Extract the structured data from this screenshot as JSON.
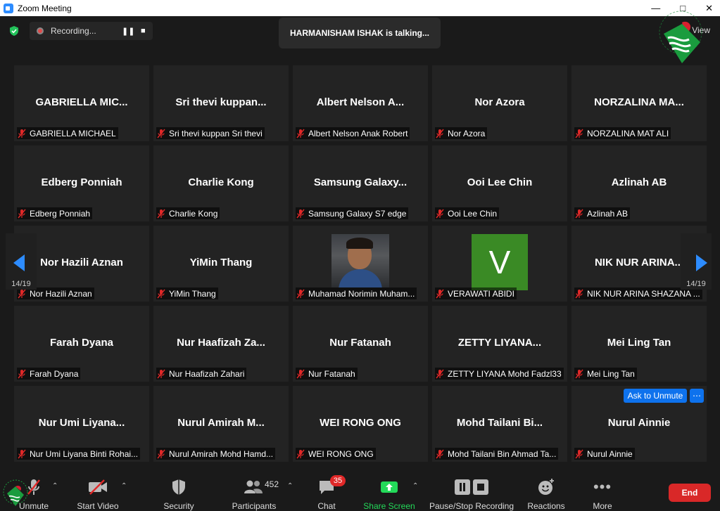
{
  "window": {
    "title": "Zoom Meeting"
  },
  "recording": {
    "label": "Recording..."
  },
  "talking": "HARMANISHAM ISHAK is talking...",
  "view_label": "View",
  "colors": {
    "end": "#d92828",
    "accent": "#0e72ed",
    "share": "#23d959",
    "mic_off": "#e02828"
  },
  "tiles": [
    {
      "name": "GABRIELLA MIC...",
      "label": "GABRIELLA MICHAEL"
    },
    {
      "name": "Sri  thevi  kuppan...",
      "label": "Sri thevi kuppan Sri thevi"
    },
    {
      "name": "Albert  Nelson  A...",
      "label": "Albert Nelson Anak Robert"
    },
    {
      "name": "Nor Azora",
      "label": "Nor Azora"
    },
    {
      "name": "NORZALINA MA...",
      "label": "NORZALINA MAT ALI"
    },
    {
      "name": "Edberg Ponniah",
      "label": "Edberg Ponniah"
    },
    {
      "name": "Charlie Kong",
      "label": "Charlie Kong"
    },
    {
      "name": "Samsung  Galaxy...",
      "label": "Samsung Galaxy S7 edge"
    },
    {
      "name": "Ooi Lee Chin",
      "label": "Ooi Lee Chin"
    },
    {
      "name": "Azlinah AB",
      "label": "Azlinah AB"
    },
    {
      "name": "Nor Hazili Aznan",
      "label": "Nor Hazili Aznan"
    },
    {
      "name": "YiMin Thang",
      "label": "YiMin Thang"
    },
    {
      "name": "",
      "label": "Muhamad Norimin Muham..."
    },
    {
      "name": "",
      "label": "VERAWATI ABIDI",
      "avatar": "V"
    },
    {
      "name": "NIK NUR ARINA...",
      "label": "NIK NUR ARINA SHAZANA ..."
    },
    {
      "name": "Farah Dyana",
      "label": "Farah Dyana"
    },
    {
      "name": "Nur  Haafizah  Za...",
      "label": "Nur Haafizah Zahari"
    },
    {
      "name": "Nur Fatanah",
      "label": "Nur Fatanah"
    },
    {
      "name": "ZETTY  LIYANA...",
      "label": "ZETTY LIYANA Mohd Fadzl33"
    },
    {
      "name": "Mei Ling Tan",
      "label": "Mei Ling Tan"
    },
    {
      "name": "Nur  Umi  Liyana...",
      "label": "Nur Umi Liyana Binti Rohai..."
    },
    {
      "name": "Nurul  Amirah  M...",
      "label": "Nurul Amirah Mohd Hamd..."
    },
    {
      "name": "WEI RONG ONG",
      "label": "WEI RONG ONG"
    },
    {
      "name": "Mohd  Tailani  Bi...",
      "label": "Mohd Tailani Bin Ahmad Ta..."
    },
    {
      "name": "Nurul Ainnie",
      "label": "Nurul Ainnie"
    }
  ],
  "ask_unmute": "Ask to Unmute",
  "more_dots": "⋯",
  "pager": {
    "left": "14/19",
    "right": "14/19"
  },
  "toolbar": {
    "unmute": "Unmute",
    "start_video": "Start Video",
    "security": "Security",
    "participants": "Participants",
    "participants_count": "452",
    "chat": "Chat",
    "chat_badge": "35",
    "share": "Share Screen",
    "record": "Pause/Stop Recording",
    "reactions": "Reactions",
    "more": "More",
    "end": "End"
  }
}
